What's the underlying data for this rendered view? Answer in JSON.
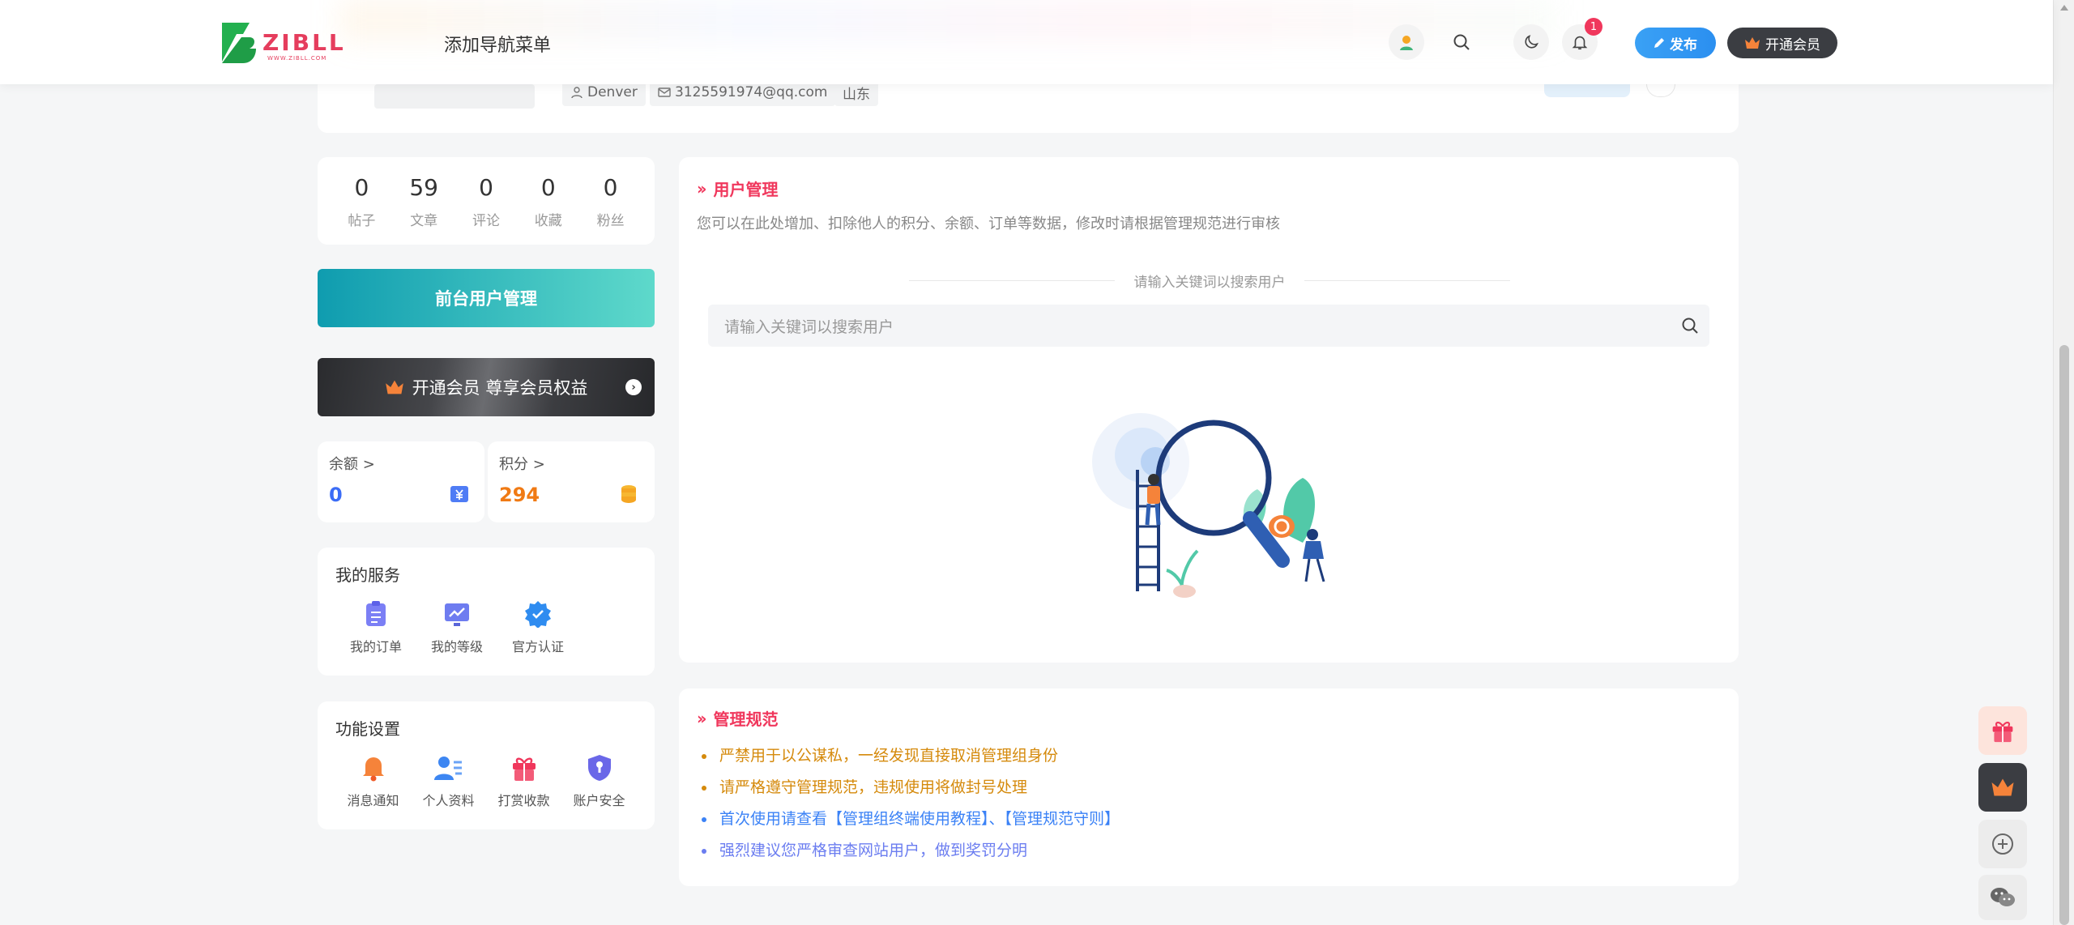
{
  "header": {
    "logo_text": "ZIBLL",
    "logo_sub": "WWW.ZIBLL.COM",
    "nav_label": "添加导航菜单",
    "notification_count": "1",
    "publish_label": "发布",
    "vip_label": "开通会员"
  },
  "profile_tags": {
    "username": "Denver",
    "email": "3125591974@qq.com",
    "location": "山东"
  },
  "stats": [
    {
      "value": "0",
      "label": "帖子"
    },
    {
      "value": "59",
      "label": "文章"
    },
    {
      "value": "0",
      "label": "评论"
    },
    {
      "value": "0",
      "label": "收藏"
    },
    {
      "value": "0",
      "label": "粉丝"
    }
  ],
  "front_manage_label": "前台用户管理",
  "vip_promo_label": "开通会员 尊享会员权益",
  "balance": {
    "label": "余额",
    "arrow": ">",
    "value": "0"
  },
  "points": {
    "label": "积分",
    "arrow": ">",
    "value": "294"
  },
  "services": {
    "title": "我的服务",
    "items": [
      {
        "label": "我的订单",
        "icon": "order-icon"
      },
      {
        "label": "我的等级",
        "icon": "level-icon"
      },
      {
        "label": "官方认证",
        "icon": "verified-icon"
      }
    ]
  },
  "settings": {
    "title": "功能设置",
    "items": [
      {
        "label": "消息通知",
        "icon": "bell-icon"
      },
      {
        "label": "个人资料",
        "icon": "profile-icon"
      },
      {
        "label": "打赏收款",
        "icon": "gift-icon"
      },
      {
        "label": "账户安全",
        "icon": "shield-icon"
      }
    ]
  },
  "user_mgmt": {
    "title": "用户管理",
    "description": "您可以在此处增加、扣除他人的积分、余额、订单等数据，修改时请根据管理规范进行审核",
    "divider_text": "请输入关键词以搜索用户",
    "search_placeholder": "请输入关键词以搜索用户"
  },
  "rules": {
    "title": "管理规范",
    "items": [
      {
        "text": "严禁用于以公谋私，一经发现直接取消管理组身份",
        "color": "#d58a0c"
      },
      {
        "text": "请严格遵守管理规范，违规使用将做封号处理",
        "color": "#d58a0c"
      },
      {
        "text": "首次使用请查看【管理组终端使用教程】、【管理规范守则】",
        "color": "#3b82f6"
      },
      {
        "text": "强烈建议您严格审查网站用户，做到奖罚分明",
        "color": "#6b7df0"
      }
    ]
  },
  "colors": {
    "accent_pink": "#f0375c",
    "balance_blue": "#3b6cf6",
    "points_orange": "#f07a14",
    "teal_start": "#0f9caf",
    "teal_end": "#5ed9cb"
  }
}
